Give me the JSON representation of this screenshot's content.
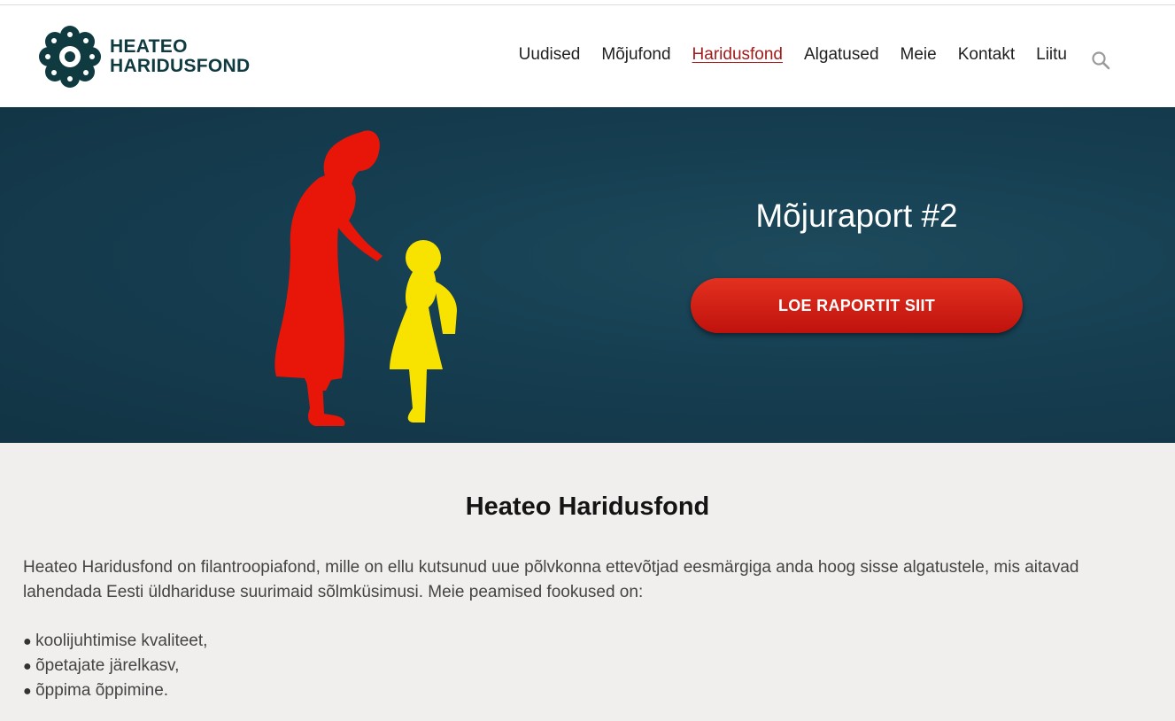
{
  "logo": {
    "line1": "HEATEO",
    "line2": "HARIDUSFOND",
    "color": "#0f3a40"
  },
  "nav": {
    "items": [
      {
        "label": "Uudised"
      },
      {
        "label": "Mõjufond"
      },
      {
        "label": "Haridusfond",
        "active": true
      },
      {
        "label": "Algatused"
      },
      {
        "label": "Meie"
      },
      {
        "label": "Kontakt"
      },
      {
        "label": "Liitu"
      }
    ],
    "search_icon": "search-icon"
  },
  "hero": {
    "title": "Mõjuraport #2",
    "cta_label": "LOE RAPORTIT SIIT",
    "background": "#163f52",
    "accent": "#d8200f"
  },
  "content": {
    "heading": "Heateo Haridusfond",
    "intro": "Heateo Haridusfond on filantroopiafond, mille on ellu kutsunud uue põlvkonna ettevõtjad eesmärgiga anda hoog sisse algatustele, mis aitavad lahendada Eesti üldhariduse suurimaid sõlmküsimusi. Meie peamised fookused on:",
    "focus_items": [
      "koolijuhtimise kvaliteet,",
      "õpetajate järelkasv,",
      "õppima õppimine."
    ]
  }
}
